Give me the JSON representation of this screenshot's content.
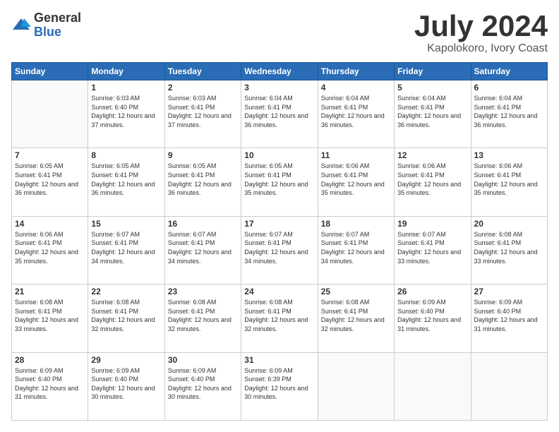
{
  "header": {
    "logo": {
      "general": "General",
      "blue": "Blue"
    },
    "title": "July 2024",
    "location": "Kapolokoro, Ivory Coast"
  },
  "calendar": {
    "days_of_week": [
      "Sunday",
      "Monday",
      "Tuesday",
      "Wednesday",
      "Thursday",
      "Friday",
      "Saturday"
    ],
    "weeks": [
      [
        {
          "day": "",
          "empty": true
        },
        {
          "day": "1",
          "sunrise": "Sunrise: 6:03 AM",
          "sunset": "Sunset: 6:40 PM",
          "daylight": "Daylight: 12 hours and 37 minutes."
        },
        {
          "day": "2",
          "sunrise": "Sunrise: 6:03 AM",
          "sunset": "Sunset: 6:41 PM",
          "daylight": "Daylight: 12 hours and 37 minutes."
        },
        {
          "day": "3",
          "sunrise": "Sunrise: 6:04 AM",
          "sunset": "Sunset: 6:41 PM",
          "daylight": "Daylight: 12 hours and 36 minutes."
        },
        {
          "day": "4",
          "sunrise": "Sunrise: 6:04 AM",
          "sunset": "Sunset: 6:41 PM",
          "daylight": "Daylight: 12 hours and 36 minutes."
        },
        {
          "day": "5",
          "sunrise": "Sunrise: 6:04 AM",
          "sunset": "Sunset: 6:41 PM",
          "daylight": "Daylight: 12 hours and 36 minutes."
        },
        {
          "day": "6",
          "sunrise": "Sunrise: 6:04 AM",
          "sunset": "Sunset: 6:41 PM",
          "daylight": "Daylight: 12 hours and 36 minutes."
        }
      ],
      [
        {
          "day": "7",
          "sunrise": "Sunrise: 6:05 AM",
          "sunset": "Sunset: 6:41 PM",
          "daylight": "Daylight: 12 hours and 36 minutes."
        },
        {
          "day": "8",
          "sunrise": "Sunrise: 6:05 AM",
          "sunset": "Sunset: 6:41 PM",
          "daylight": "Daylight: 12 hours and 36 minutes."
        },
        {
          "day": "9",
          "sunrise": "Sunrise: 6:05 AM",
          "sunset": "Sunset: 6:41 PM",
          "daylight": "Daylight: 12 hours and 36 minutes."
        },
        {
          "day": "10",
          "sunrise": "Sunrise: 6:05 AM",
          "sunset": "Sunset: 6:41 PM",
          "daylight": "Daylight: 12 hours and 35 minutes."
        },
        {
          "day": "11",
          "sunrise": "Sunrise: 6:06 AM",
          "sunset": "Sunset: 6:41 PM",
          "daylight": "Daylight: 12 hours and 35 minutes."
        },
        {
          "day": "12",
          "sunrise": "Sunrise: 6:06 AM",
          "sunset": "Sunset: 6:41 PM",
          "daylight": "Daylight: 12 hours and 35 minutes."
        },
        {
          "day": "13",
          "sunrise": "Sunrise: 6:06 AM",
          "sunset": "Sunset: 6:41 PM",
          "daylight": "Daylight: 12 hours and 35 minutes."
        }
      ],
      [
        {
          "day": "14",
          "sunrise": "Sunrise: 6:06 AM",
          "sunset": "Sunset: 6:41 PM",
          "daylight": "Daylight: 12 hours and 35 minutes."
        },
        {
          "day": "15",
          "sunrise": "Sunrise: 6:07 AM",
          "sunset": "Sunset: 6:41 PM",
          "daylight": "Daylight: 12 hours and 34 minutes."
        },
        {
          "day": "16",
          "sunrise": "Sunrise: 6:07 AM",
          "sunset": "Sunset: 6:41 PM",
          "daylight": "Daylight: 12 hours and 34 minutes."
        },
        {
          "day": "17",
          "sunrise": "Sunrise: 6:07 AM",
          "sunset": "Sunset: 6:41 PM",
          "daylight": "Daylight: 12 hours and 34 minutes."
        },
        {
          "day": "18",
          "sunrise": "Sunrise: 6:07 AM",
          "sunset": "Sunset: 6:41 PM",
          "daylight": "Daylight: 12 hours and 34 minutes."
        },
        {
          "day": "19",
          "sunrise": "Sunrise: 6:07 AM",
          "sunset": "Sunset: 6:41 PM",
          "daylight": "Daylight: 12 hours and 33 minutes."
        },
        {
          "day": "20",
          "sunrise": "Sunrise: 6:08 AM",
          "sunset": "Sunset: 6:41 PM",
          "daylight": "Daylight: 12 hours and 33 minutes."
        }
      ],
      [
        {
          "day": "21",
          "sunrise": "Sunrise: 6:08 AM",
          "sunset": "Sunset: 6:41 PM",
          "daylight": "Daylight: 12 hours and 33 minutes."
        },
        {
          "day": "22",
          "sunrise": "Sunrise: 6:08 AM",
          "sunset": "Sunset: 6:41 PM",
          "daylight": "Daylight: 12 hours and 32 minutes."
        },
        {
          "day": "23",
          "sunrise": "Sunrise: 6:08 AM",
          "sunset": "Sunset: 6:41 PM",
          "daylight": "Daylight: 12 hours and 32 minutes."
        },
        {
          "day": "24",
          "sunrise": "Sunrise: 6:08 AM",
          "sunset": "Sunset: 6:41 PM",
          "daylight": "Daylight: 12 hours and 32 minutes."
        },
        {
          "day": "25",
          "sunrise": "Sunrise: 6:08 AM",
          "sunset": "Sunset: 6:41 PM",
          "daylight": "Daylight: 12 hours and 32 minutes."
        },
        {
          "day": "26",
          "sunrise": "Sunrise: 6:09 AM",
          "sunset": "Sunset: 6:40 PM",
          "daylight": "Daylight: 12 hours and 31 minutes."
        },
        {
          "day": "27",
          "sunrise": "Sunrise: 6:09 AM",
          "sunset": "Sunset: 6:40 PM",
          "daylight": "Daylight: 12 hours and 31 minutes."
        }
      ],
      [
        {
          "day": "28",
          "sunrise": "Sunrise: 6:09 AM",
          "sunset": "Sunset: 6:40 PM",
          "daylight": "Daylight: 12 hours and 31 minutes."
        },
        {
          "day": "29",
          "sunrise": "Sunrise: 6:09 AM",
          "sunset": "Sunset: 6:40 PM",
          "daylight": "Daylight: 12 hours and 30 minutes."
        },
        {
          "day": "30",
          "sunrise": "Sunrise: 6:09 AM",
          "sunset": "Sunset: 6:40 PM",
          "daylight": "Daylight: 12 hours and 30 minutes."
        },
        {
          "day": "31",
          "sunrise": "Sunrise: 6:09 AM",
          "sunset": "Sunset: 6:39 PM",
          "daylight": "Daylight: 12 hours and 30 minutes."
        },
        {
          "day": "",
          "empty": true
        },
        {
          "day": "",
          "empty": true
        },
        {
          "day": "",
          "empty": true
        }
      ]
    ]
  }
}
